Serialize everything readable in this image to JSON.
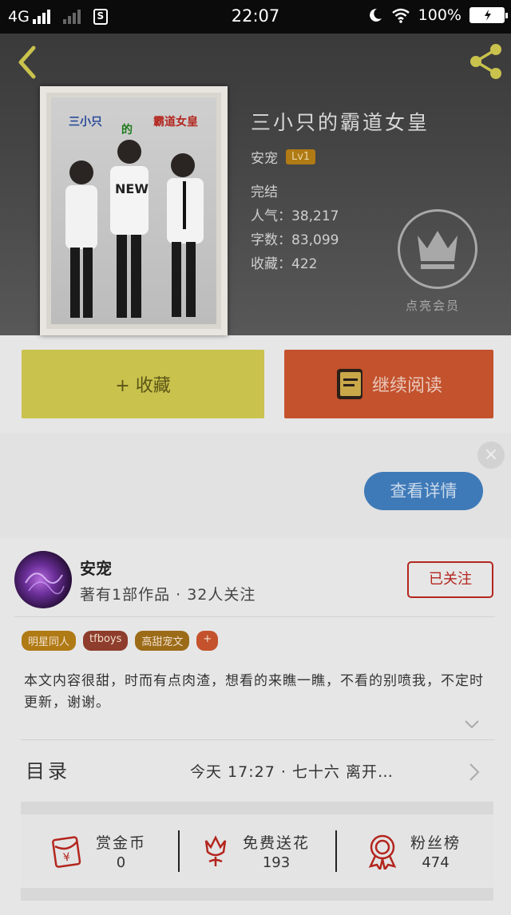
{
  "status_bar": {
    "network": "4G",
    "time": "22:07",
    "battery": "100%"
  },
  "book": {
    "title": "三小只的霸道女皇",
    "cover_text_left": "三小只",
    "cover_text_mid": "的",
    "cover_text_right": "霸道女皇",
    "author": "安宠",
    "level": "Lv1",
    "status": "完结",
    "popularity": "人气：38,217",
    "word_count": "字数：83,099",
    "favorites": "收藏：422"
  },
  "vip": {
    "label": "点亮会员"
  },
  "actions": {
    "collect": "+ 收藏",
    "continue_reading": "继续阅读"
  },
  "ad": {
    "close": "×",
    "detail": "查看详情"
  },
  "author": {
    "name": "安宠",
    "stats": "著有1部作品 · 32人关注",
    "follow": "已关注"
  },
  "tags": [
    {
      "label": "明星同人",
      "color": "#b07a14"
    },
    {
      "label": "tfboys",
      "color": "#8e3c2c"
    },
    {
      "label": "高甜宠文",
      "color": "#9c6b18"
    },
    {
      "label": "+",
      "color": "#c3522d"
    }
  ],
  "description": "本文内容很甜，时而有点肉渣，想看的来瞧一瞧，不看的别喷我，不定时更新，谢谢。",
  "toc": {
    "label": "目录",
    "latest": "今天 17:27 · 七十六    离开…"
  },
  "stats": {
    "reward": {
      "label": "赏金币",
      "value": "0"
    },
    "flowers": {
      "label": "免费送花",
      "value": "193"
    },
    "fans": {
      "label": "粉丝榜",
      "value": "474"
    }
  },
  "colors": {
    "accent_red": "#b3261e",
    "collect_bg": "#c9c24d",
    "read_bg": "#c3522d",
    "detail_bg": "#3f7ab8"
  }
}
